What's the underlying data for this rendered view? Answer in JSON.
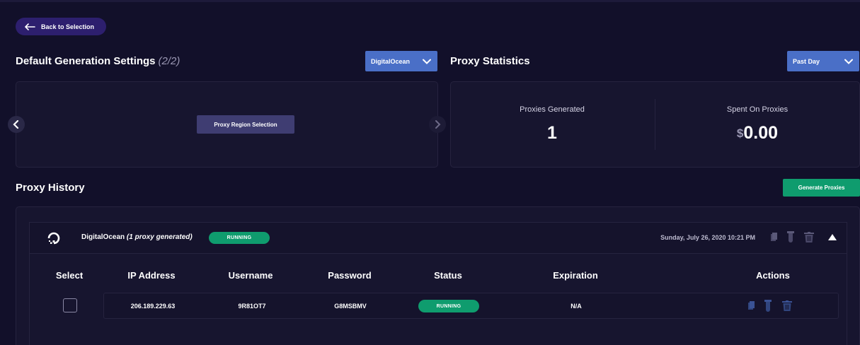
{
  "nav": {
    "back_label": "Back to Selection"
  },
  "generation": {
    "title": "Default Generation Settings",
    "count": "(2/2)",
    "provider": "DigitalOcean",
    "region_button": "Proxy Region Selection"
  },
  "stats": {
    "title": "Proxy Statistics",
    "period": "Past Day",
    "generated_label": "Proxies Generated",
    "generated_value": "1",
    "spent_label": "Spent On Proxies",
    "currency": "$",
    "spent_value": "0.00"
  },
  "history": {
    "title": "Proxy History",
    "generate_button": "Generate Proxies",
    "group": {
      "provider": "DigitalOcean",
      "summary": "(1 proxy generated)",
      "status": "RUNNING",
      "date": "Sunday, July 26, 2020 10:21 PM"
    },
    "columns": [
      "Select",
      "IP Address",
      "Username",
      "Password",
      "Status",
      "Expiration",
      "Actions"
    ],
    "rows": [
      {
        "ip": "206.189.229.63",
        "username": "9R81OT7",
        "password": "G8MSBMV",
        "status": "RUNNING",
        "expiration": "N/A"
      }
    ]
  },
  "colors": {
    "background": "#12102a",
    "accent_blue": "#4a6fc7",
    "running_green": "#0f9c6e",
    "back_button": "#2d1f6e"
  },
  "icons": [
    "arrow-left-icon",
    "chevron-down-icon",
    "chevron-left-icon",
    "chevron-right-icon",
    "digitalocean-logo-icon",
    "copy-icon",
    "tube-icon",
    "trash-icon",
    "caret-up-icon"
  ]
}
